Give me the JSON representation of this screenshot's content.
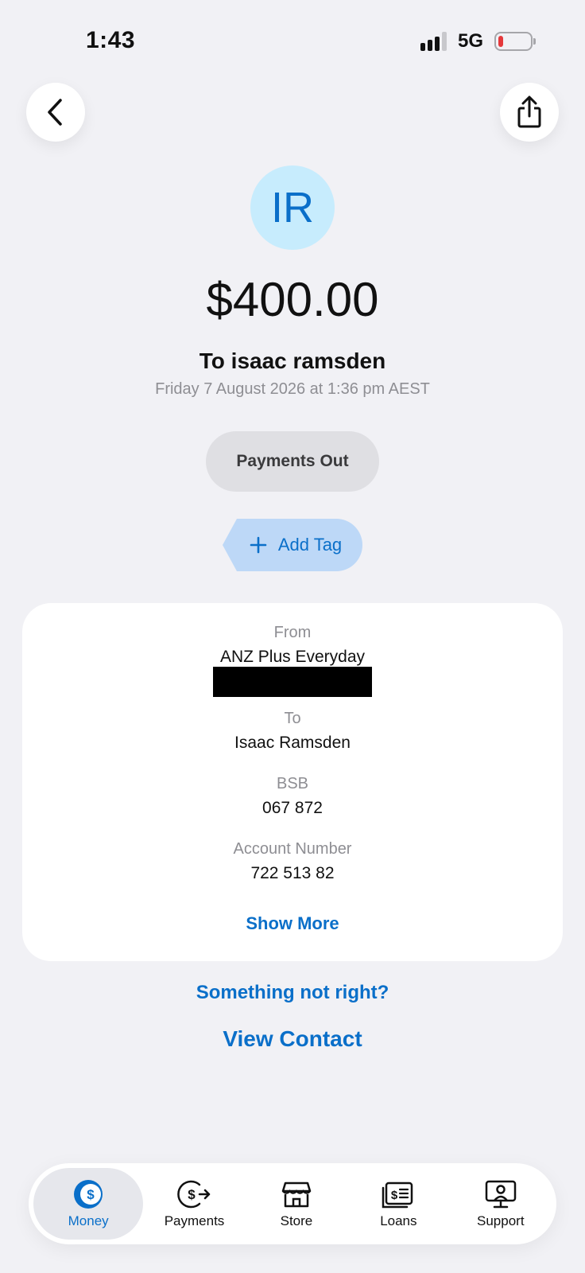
{
  "status_bar": {
    "time": "1:43",
    "network": "5G",
    "battery_level": 0.15
  },
  "transaction": {
    "avatar_initials": "IR",
    "amount": "$400.00",
    "recipient": "To isaac ramsden",
    "datetime": "Friday 7 August 2026 at 1:36 pm AEST",
    "category": "Payments Out",
    "add_tag_label": "Add Tag"
  },
  "details": {
    "from_label": "From",
    "from_value": "ANZ Plus Everyday",
    "to_label": "To",
    "to_value": "Isaac Ramsden",
    "bsb_label": "BSB",
    "bsb_value": "067 872",
    "account_label": "Account Number",
    "account_value": "722 513 82",
    "show_more": "Show More"
  },
  "links": {
    "something_wrong": "Something not right?",
    "view_contact": "View Contact"
  },
  "nav": [
    {
      "label": "Money",
      "icon": "money-icon",
      "active": true
    },
    {
      "label": "Payments",
      "icon": "payments-icon",
      "active": false
    },
    {
      "label": "Store",
      "icon": "store-icon",
      "active": false
    },
    {
      "label": "Loans",
      "icon": "loans-icon",
      "active": false
    },
    {
      "label": "Support",
      "icon": "support-icon",
      "active": false
    }
  ],
  "colors": {
    "accent": "#0a6fc9",
    "background": "#f1f1f5",
    "avatar_bg": "#c7ecfd",
    "tag_bg": "#bdd8f7",
    "battery_low": "#e5383b"
  }
}
